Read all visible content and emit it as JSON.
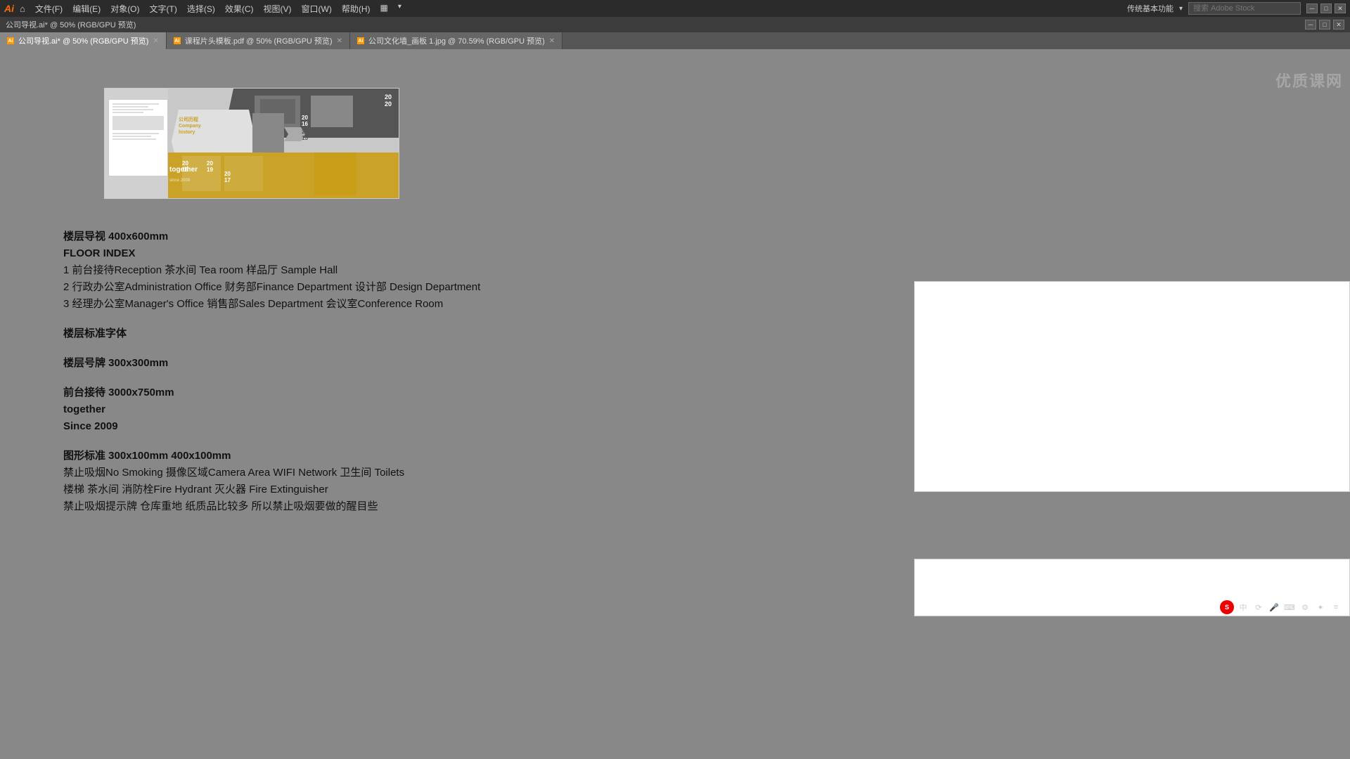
{
  "app": {
    "logo": "Ai",
    "title": "公司导视.ai* @ 50% (RGB/GPU 预览)"
  },
  "menu": {
    "file": "文件(F)",
    "edit": "编辑(E)",
    "object": "对象(O)",
    "text": "文字(T)",
    "select": "选择(S)",
    "effect": "效果(C)",
    "view": "视图(V)",
    "window": "窗口(W)",
    "help": "帮助(H)",
    "layout_icon": "▦",
    "right_text": "传统基本功能",
    "search_placeholder": "搜索 Adobe Stock"
  },
  "tabs": [
    {
      "label": "公司导视.ai* @ 50% (RGB/GPU 预览)",
      "active": true
    },
    {
      "label": "课程片头模板.pdf @ 50% (RGB/GPU 预览)",
      "active": false
    },
    {
      "label": "公司文化墙_画板 1.jpg @ 70.59% (RGB/GPU 预览)",
      "active": false
    }
  ],
  "content": {
    "floor_heading": "楼层导视 400x600mm",
    "floor_index": "FLOOR INDEX",
    "floor_line1": "1  前台接待Reception  茶水间 Tea room 样品厅 Sample Hall",
    "floor_line2": "2 行政办公室Administration Office 财务部Finance Department 设计部 Design Department",
    "floor_line3": "3 经理办公室Manager's Office 销售部Sales Department 会议室Conference Room",
    "standard_font": "楼层标准字体",
    "floor_sign": "楼层号牌 300x300mm",
    "reception": "前台接待 3000x750mm",
    "together": "together",
    "since": "Since 2009",
    "graphic_std": "图形标准 300x100mm  400x100mm",
    "graphic_line1": "禁止吸烟No Smoking 摄像区域Camera Area WIFI Network 卫生间 Toilets",
    "graphic_line2": "楼梯 茶水间 消防栓Fire Hydrant 灭火器 Fire Extinguisher",
    "graphic_line3": "禁止吸烟提示牌 仓库重地 纸质品比较多 所以禁止吸烟要做的醒目些"
  },
  "watermark": {
    "line1": "优质课网",
    "symbol": "▶"
  }
}
